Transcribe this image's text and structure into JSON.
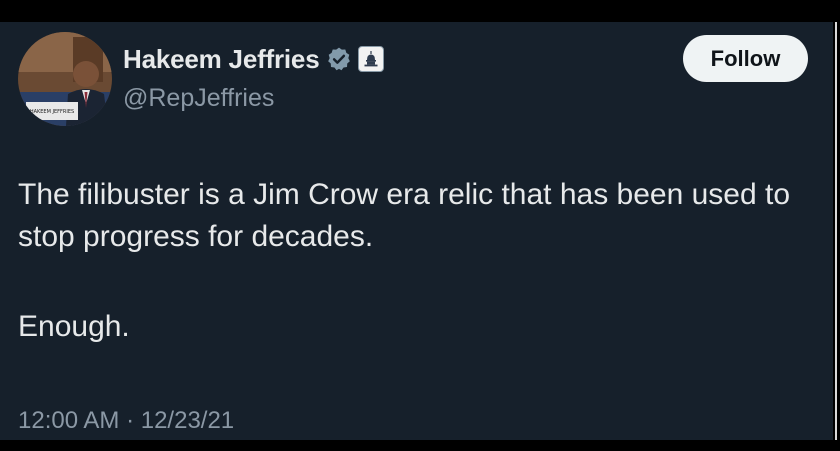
{
  "author": {
    "display_name": "Hakeem Jeffries",
    "handle": "@RepJeffries",
    "verified_icon": "verified-checkmark-icon",
    "affiliation_icon": "capitol-dome-icon",
    "avatar_caption": "HAKEEM JEFFRIES"
  },
  "actions": {
    "follow_label": "Follow"
  },
  "tweet": {
    "line1": "The filibuster is a Jim Crow era relic that has been used to stop progress for decades.",
    "line2": "Enough.",
    "timestamp": "12:00 AM · 12/23/21"
  },
  "colors": {
    "background": "#16202b",
    "text_primary": "#e7e9ea",
    "text_secondary": "#8b98a5",
    "button_bg": "#eff3f4"
  }
}
